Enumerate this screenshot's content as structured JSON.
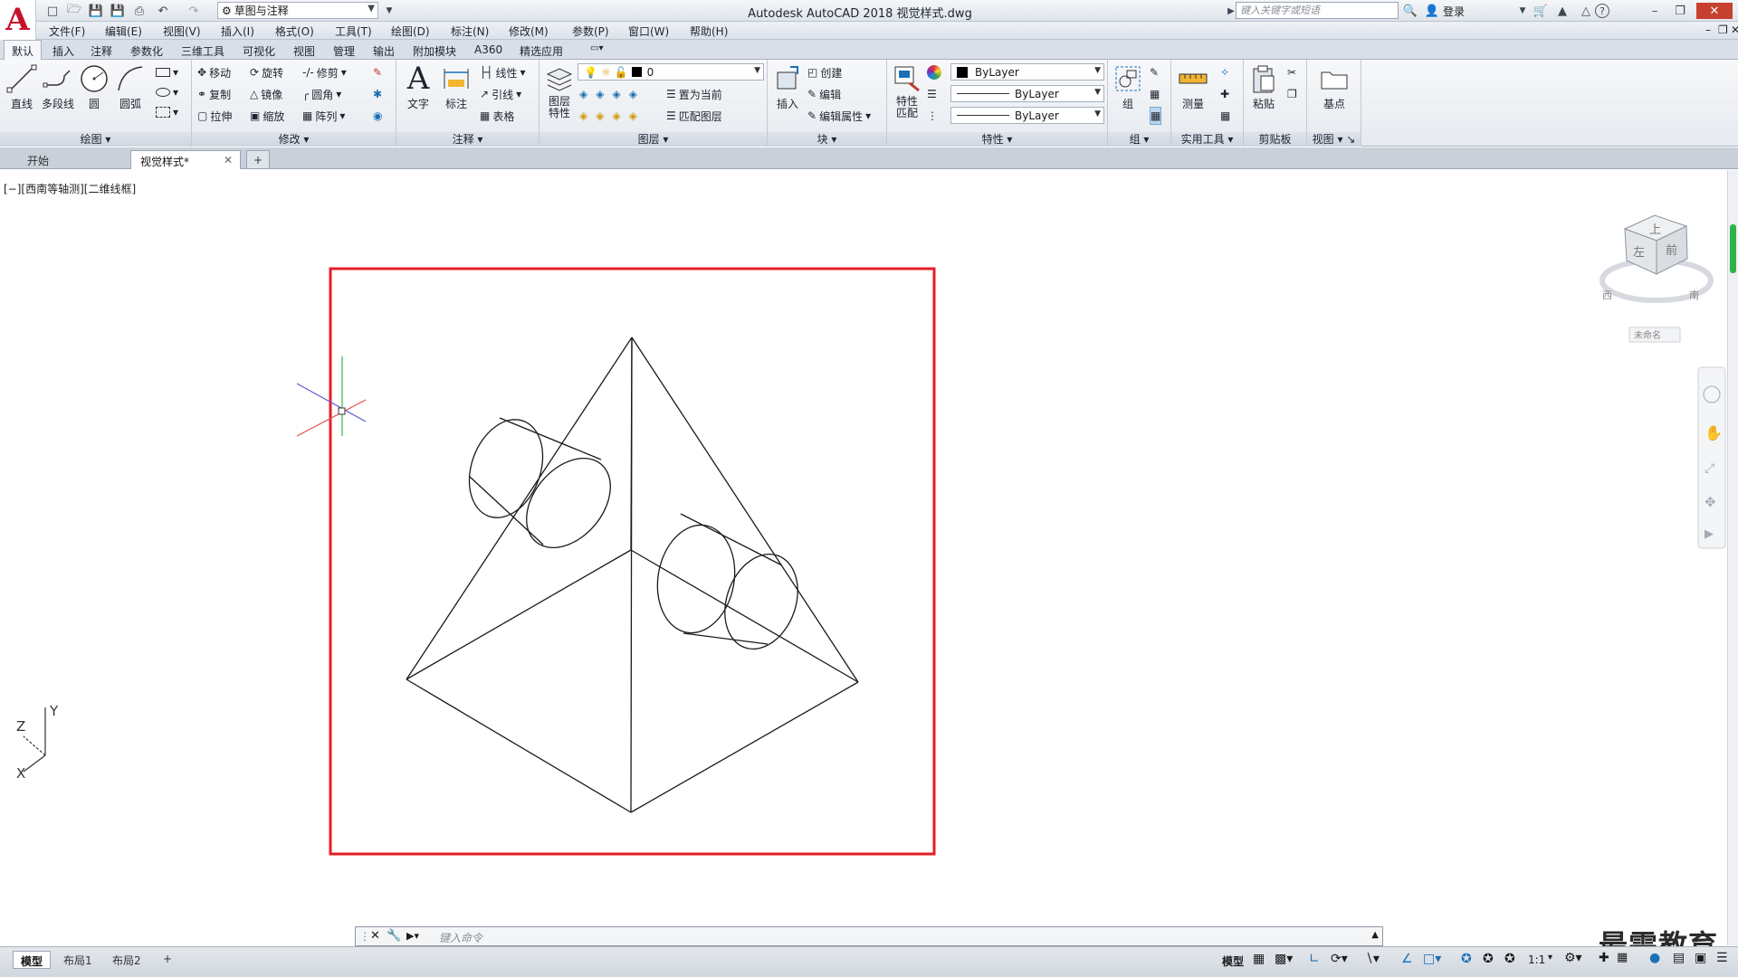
{
  "app": {
    "window_title": "Autodesk AutoCAD 2018    视觉样式.dwg",
    "workspace": "草图与注释",
    "search_placeholder": "键入关键字或短语",
    "login_label": "登录"
  },
  "menubar": [
    "文件(F)",
    "编辑(E)",
    "视图(V)",
    "插入(I)",
    "格式(O)",
    "工具(T)",
    "绘图(D)",
    "标注(N)",
    "修改(M)",
    "参数(P)",
    "窗口(W)",
    "帮助(H)"
  ],
  "ribbon_tabs": [
    "默认",
    "插入",
    "注释",
    "参数化",
    "三维工具",
    "可视化",
    "视图",
    "管理",
    "输出",
    "附加模块",
    "A360",
    "精选应用"
  ],
  "ribbon": {
    "draw": {
      "title": "绘图",
      "line": "直线",
      "polyline": "多段线",
      "circle": "圆",
      "arc": "圆弧"
    },
    "modify": {
      "title": "修改",
      "move": "移动",
      "rotate": "旋转",
      "trim": "修剪",
      "copy": "复制",
      "mirror": "镜像",
      "fillet": "圆角",
      "stretch": "拉伸",
      "scale": "缩放",
      "array": "阵列"
    },
    "annotation": {
      "title": "注释",
      "text": "文字",
      "dimension": "标注",
      "linear": "线性",
      "leader": "引线",
      "table": "表格"
    },
    "layers": {
      "title": "图层",
      "layer_props": "图层\n特性",
      "current_layer": "0",
      "make_current": "置为当前",
      "match_layer": "匹配图层"
    },
    "block": {
      "title": "块",
      "insert": "插入",
      "create": "创建",
      "edit": "编辑",
      "edit_attr": "编辑属性"
    },
    "properties": {
      "title": "特性",
      "match": "特性\n匹配",
      "color": "ByLayer",
      "linetype": "ByLayer",
      "lineweight": "ByLayer"
    },
    "groups": {
      "title": "组",
      "group": "组"
    },
    "utilities": {
      "title": "实用工具",
      "measure": "测量"
    },
    "clipboard": {
      "title": "剪贴板",
      "paste": "粘贴"
    },
    "view": {
      "title": "视图",
      "base": "基点"
    }
  },
  "file_tabs": [
    "开始",
    "视觉样式*"
  ],
  "viewport_label": "[−][西南等轴测][二维线框]",
  "viewcube": {
    "top": "上",
    "left": "左",
    "front": "前",
    "west": "西",
    "south": "南",
    "unnamed": "未命名"
  },
  "ucs": {
    "x": "X",
    "y": "Y",
    "z": "Z"
  },
  "command_placeholder": "键入命令",
  "layout_tabs": [
    "模型",
    "布局1",
    "布局2"
  ],
  "status": {
    "model": "模型",
    "scale": "1:1"
  },
  "watermark": "最需教育",
  "colors": {
    "highlight_frame": "#e51e25",
    "autocad_red": "#c8102e"
  }
}
